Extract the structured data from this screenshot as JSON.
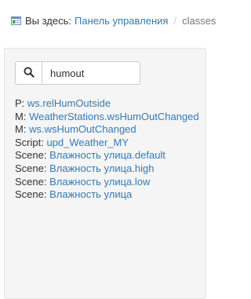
{
  "breadcrumb": {
    "prefix": "Вы здесь:",
    "home_label": "Панель управления",
    "separator": "/",
    "current": "classes"
  },
  "search": {
    "value": "humout",
    "icon": "search-icon"
  },
  "results": [
    {
      "type": "P:",
      "name": "ws.relHumOutside"
    },
    {
      "type": "M:",
      "name": "WeatherStations.wsHumOutChanged"
    },
    {
      "type": "M:",
      "name": "ws.wsHumOutChanged"
    },
    {
      "type": "Script:",
      "name": "upd_Weather_MY"
    },
    {
      "type": "Scene:",
      "name": "Влажность улица.default"
    },
    {
      "type": "Scene:",
      "name": "Влажность улица.high"
    },
    {
      "type": "Scene:",
      "name": "Влажность улица.low"
    },
    {
      "type": "Scene:",
      "name": "Влажность улица"
    }
  ],
  "colors": {
    "link": "#337ab7",
    "text": "#333333",
    "panel_bg": "#f5f5f5"
  }
}
